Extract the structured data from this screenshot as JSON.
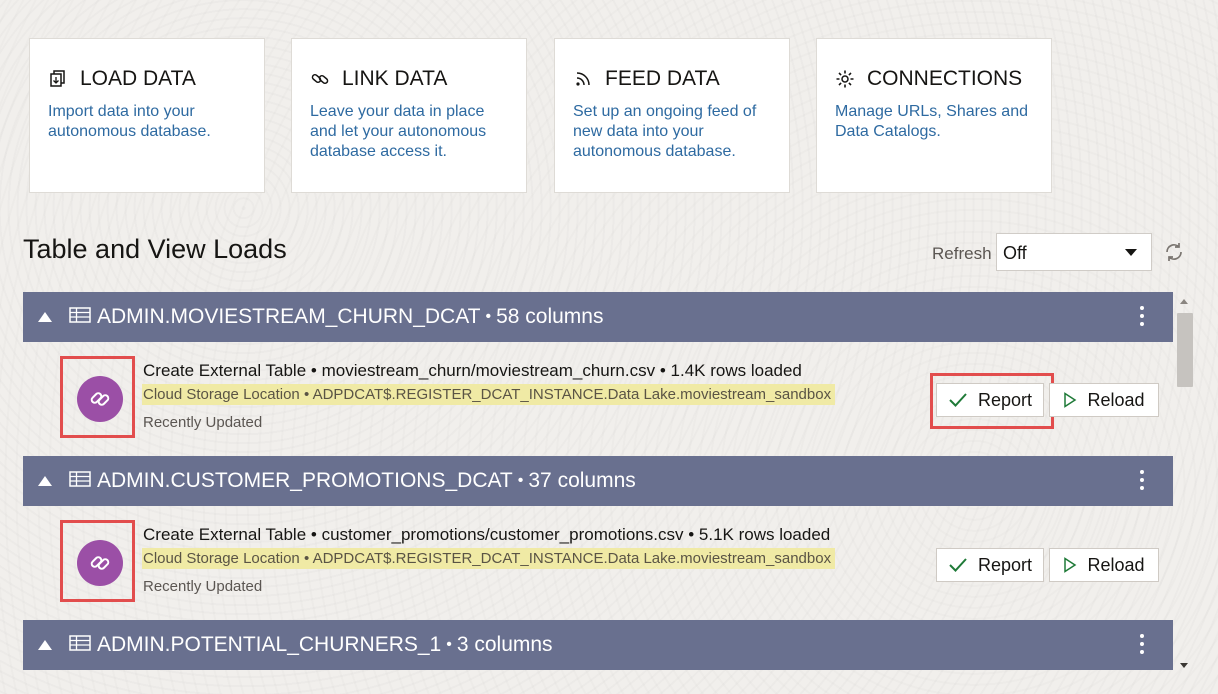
{
  "cards": [
    {
      "title": "LOAD DATA",
      "icon": "load-data-icon",
      "desc": [
        "Import data into your",
        "autonomous database."
      ]
    },
    {
      "title": "LINK DATA",
      "icon": "link-icon",
      "desc": [
        "Leave your data in place",
        "and let your autonomous",
        "database access it."
      ]
    },
    {
      "title": "FEED DATA",
      "icon": "feed-icon",
      "desc": [
        "Set up an ongoing feed of",
        "new data into your",
        "autonomous database."
      ]
    },
    {
      "title": "CONNECTIONS",
      "icon": "gear-icon",
      "desc": [
        "Manage URLs, Shares and",
        "Data Catalogs."
      ]
    }
  ],
  "section_title": "Table and View Loads",
  "refresh": {
    "label": "Refresh",
    "value": "Off"
  },
  "loads": [
    {
      "name": "ADMIN.MOVIESTREAM_CHURN_DCAT",
      "columns": "58 columns",
      "action": "Create External Table",
      "source": "moviestream_churn/moviestream_churn.csv",
      "rows": "1.4K rows loaded",
      "location_label": "Cloud Storage Location",
      "location": "ADPDCAT$.REGISTER_DCAT_INSTANCE.Data Lake.moviestream_sandbox",
      "status": "Recently Updated",
      "report_label": "Report",
      "reload_label": "Reload"
    },
    {
      "name": "ADMIN.CUSTOMER_PROMOTIONS_DCAT",
      "columns": "37 columns",
      "action": "Create External Table",
      "source": "customer_promotions/customer_promotions.csv",
      "rows": "5.1K rows loaded",
      "location_label": "Cloud Storage Location",
      "location": "ADPDCAT$.REGISTER_DCAT_INSTANCE.Data Lake.moviestream_sandbox",
      "status": "Recently Updated",
      "report_label": "Report",
      "reload_label": "Reload"
    },
    {
      "name": "ADMIN.POTENTIAL_CHURNERS_1",
      "columns": "3 columns"
    }
  ],
  "separator": "•",
  "colors": {
    "header": "#69708f",
    "link": "#2e6aa1",
    "avatar": "#9b4fa6",
    "highlight": "#f0eaa5",
    "callout": "#e24d4d"
  }
}
